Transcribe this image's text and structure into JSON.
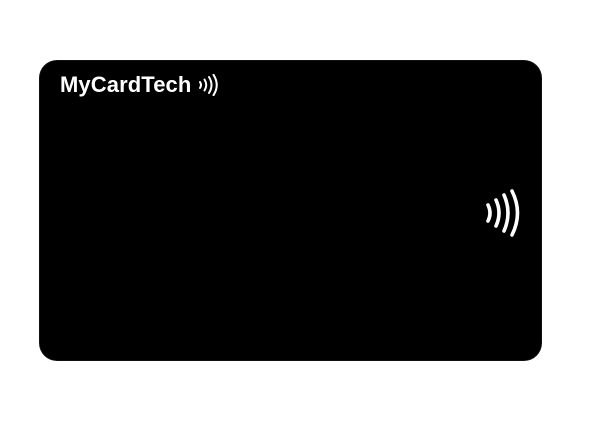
{
  "card": {
    "brand": "MyCardTech",
    "brand_icon": "contactless-waves-icon",
    "contactless_icon": "contactless-payment-icon",
    "colors": {
      "card": "#000000",
      "text": "#ffffff",
      "background": "#ffffff"
    }
  }
}
